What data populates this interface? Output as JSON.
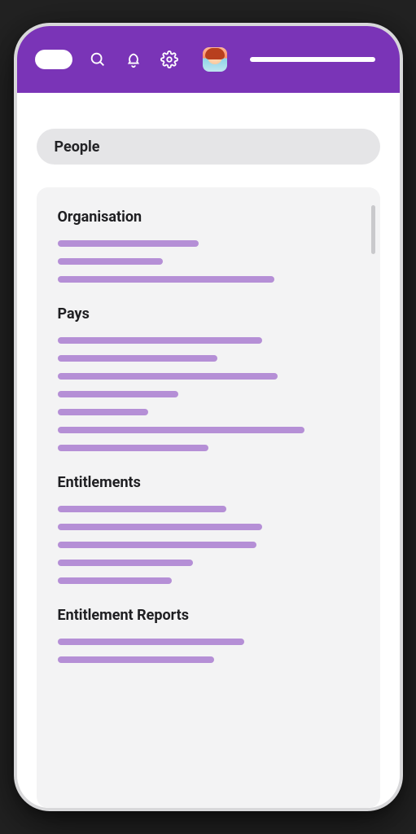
{
  "page": {
    "title": "People"
  },
  "colors": {
    "brand": "#7a34b7",
    "link": "#b58fd6"
  },
  "sections": [
    {
      "heading": "Organisation",
      "link_widths": [
        47,
        35,
        72
      ]
    },
    {
      "heading": "Pays",
      "link_widths": [
        68,
        53,
        73,
        40,
        30,
        82,
        50
      ]
    },
    {
      "heading": "Entitlements",
      "link_widths": [
        56,
        68,
        66,
        45,
        38
      ]
    },
    {
      "heading": "Entitlement Reports",
      "link_widths": [
        62,
        52
      ]
    }
  ]
}
